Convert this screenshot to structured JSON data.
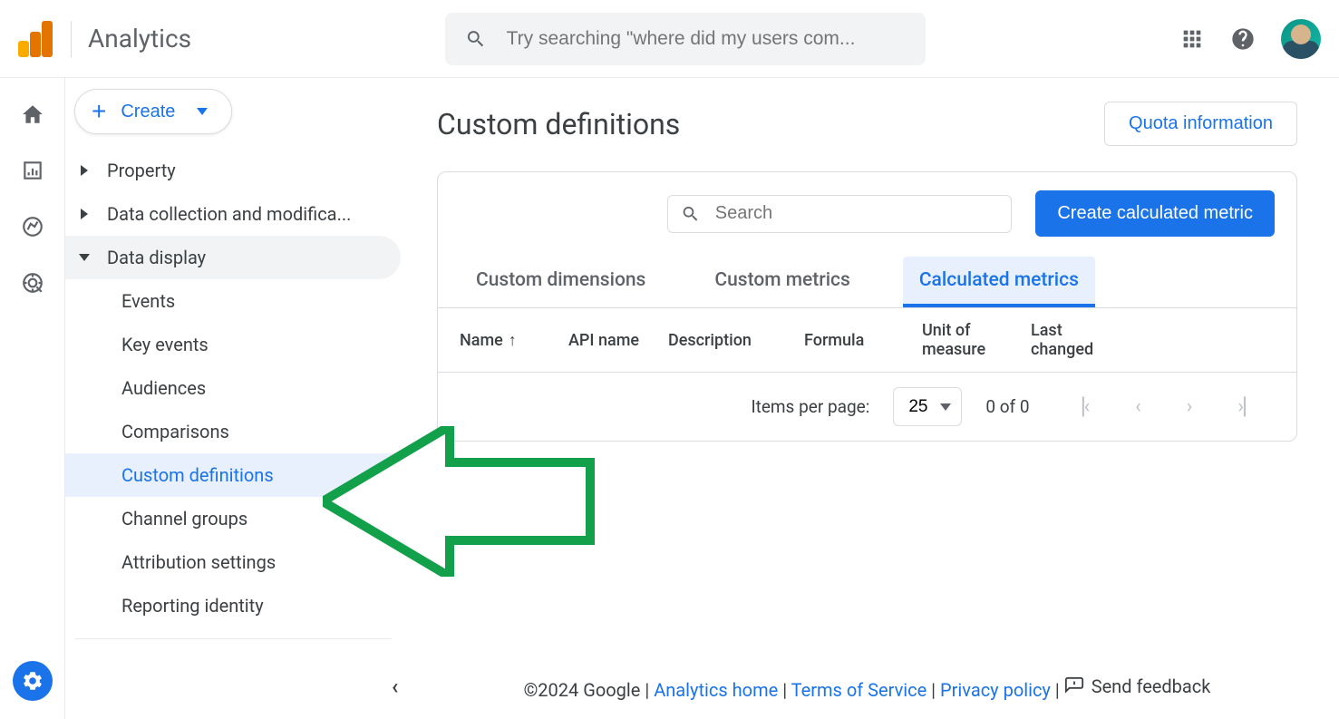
{
  "header": {
    "app_title": "Analytics",
    "search_placeholder": "Try searching \"where did my users com..."
  },
  "nav": {
    "create_label": "Create",
    "items": [
      {
        "label": "Property",
        "expanded": false
      },
      {
        "label": "Data collection and modifica...",
        "expanded": false
      },
      {
        "label": "Data display",
        "expanded": true
      }
    ],
    "data_display_children": [
      "Events",
      "Key events",
      "Audiences",
      "Comparisons",
      "Custom definitions",
      "Channel groups",
      "Attribution settings",
      "Reporting identity"
    ],
    "selected_child": "Custom definitions"
  },
  "page": {
    "title": "Custom definitions",
    "quota_btn": "Quota information",
    "search_placeholder": "Search",
    "primary_action": "Create calculated metric",
    "tabs": [
      "Custom dimensions",
      "Custom metrics",
      "Calculated metrics"
    ],
    "active_tab": "Calculated metrics",
    "columns": {
      "name": "Name",
      "api": "API name",
      "desc": "Description",
      "formula": "Formula",
      "unit": "Unit of measure",
      "last": "Last changed"
    },
    "paginator": {
      "label": "Items per page:",
      "page_size": "25",
      "range": "0 of 0"
    }
  },
  "footer": {
    "copyright": "©2024 Google",
    "links": [
      "Analytics home",
      "Terms of Service",
      "Privacy policy"
    ],
    "feedback": "Send feedback"
  }
}
